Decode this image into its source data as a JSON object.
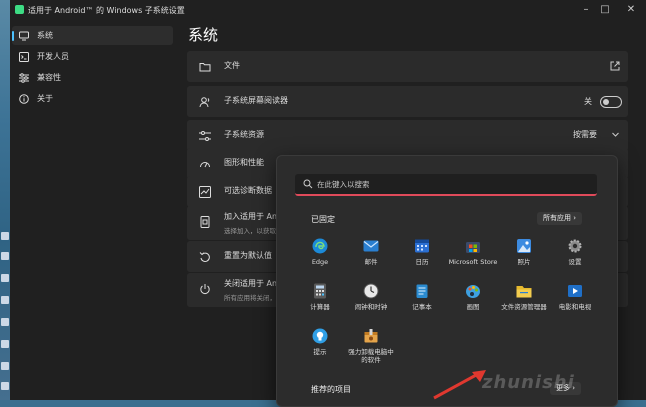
{
  "window": {
    "title": "适用于 Android™ 的 Windows 子系统设置",
    "controls": {
      "minimize": "–",
      "maximize": "□",
      "close": "✕"
    }
  },
  "sidebar": {
    "items": [
      {
        "label": "系统",
        "icon": "monitor-icon"
      },
      {
        "label": "开发人员",
        "icon": "dev-icon"
      },
      {
        "label": "兼容性",
        "icon": "sliders-icon"
      },
      {
        "label": "关于",
        "icon": "info-icon"
      }
    ]
  },
  "main": {
    "title": "系统",
    "cards": [
      {
        "label": "文件",
        "icon": "folder-icon"
      },
      {
        "label": "子系统屏幕阅读器",
        "icon": "narrator-icon",
        "toggle_label": "关"
      },
      {
        "label": "子系统资源",
        "icon": "sliders-icon",
        "value": "按需要"
      },
      {
        "label": "图形和性能",
        "icon": "gauge-icon"
      },
      {
        "label": "可选诊断数据",
        "icon": "chart-icon"
      },
      {
        "label": "加入适用于 Andr",
        "sub": "选择加入，以获取适",
        "icon": "device-icon"
      },
      {
        "label": "重置为默认值",
        "sub": "",
        "icon": "reset-icon"
      },
      {
        "label": "关闭适用于 Andr",
        "sub": "所有应用将关闭，适",
        "icon": "power-icon"
      }
    ]
  },
  "start_menu": {
    "search_placeholder": "在此键入以搜索",
    "pinned_title": "已固定",
    "all_apps_label": "所有应用  ›",
    "recommended_title": "推荐的项目",
    "more_label": "更多  ›",
    "apps": [
      {
        "label": "Edge",
        "color": "#1c8ad8"
      },
      {
        "label": "邮件",
        "color": "#2a7fd0"
      },
      {
        "label": "日历",
        "color": "#2b6fd3"
      },
      {
        "label": "Microsoft Store",
        "color": "#3b4a6a"
      },
      {
        "label": "照片",
        "color": "#3d8be0"
      },
      {
        "label": "设置",
        "color": "#8a8a8a"
      },
      {
        "label": "计算器",
        "color": "#5a5a5a"
      },
      {
        "label": "闹钟和时钟",
        "color": "#e8e8e8"
      },
      {
        "label": "记事本",
        "color": "#2a8bd0"
      },
      {
        "label": "画图",
        "color": "#3da0e0"
      },
      {
        "label": "文件资源管理器",
        "color": "#e6b92e"
      },
      {
        "label": "电影和电视",
        "color": "#1f6fc7"
      },
      {
        "label": "提示",
        "color": "#2f9fe6"
      },
      {
        "label": "强力卸载电脑中\n的软件",
        "color": "#e5a44a"
      }
    ]
  },
  "watermark": "zhunishi"
}
